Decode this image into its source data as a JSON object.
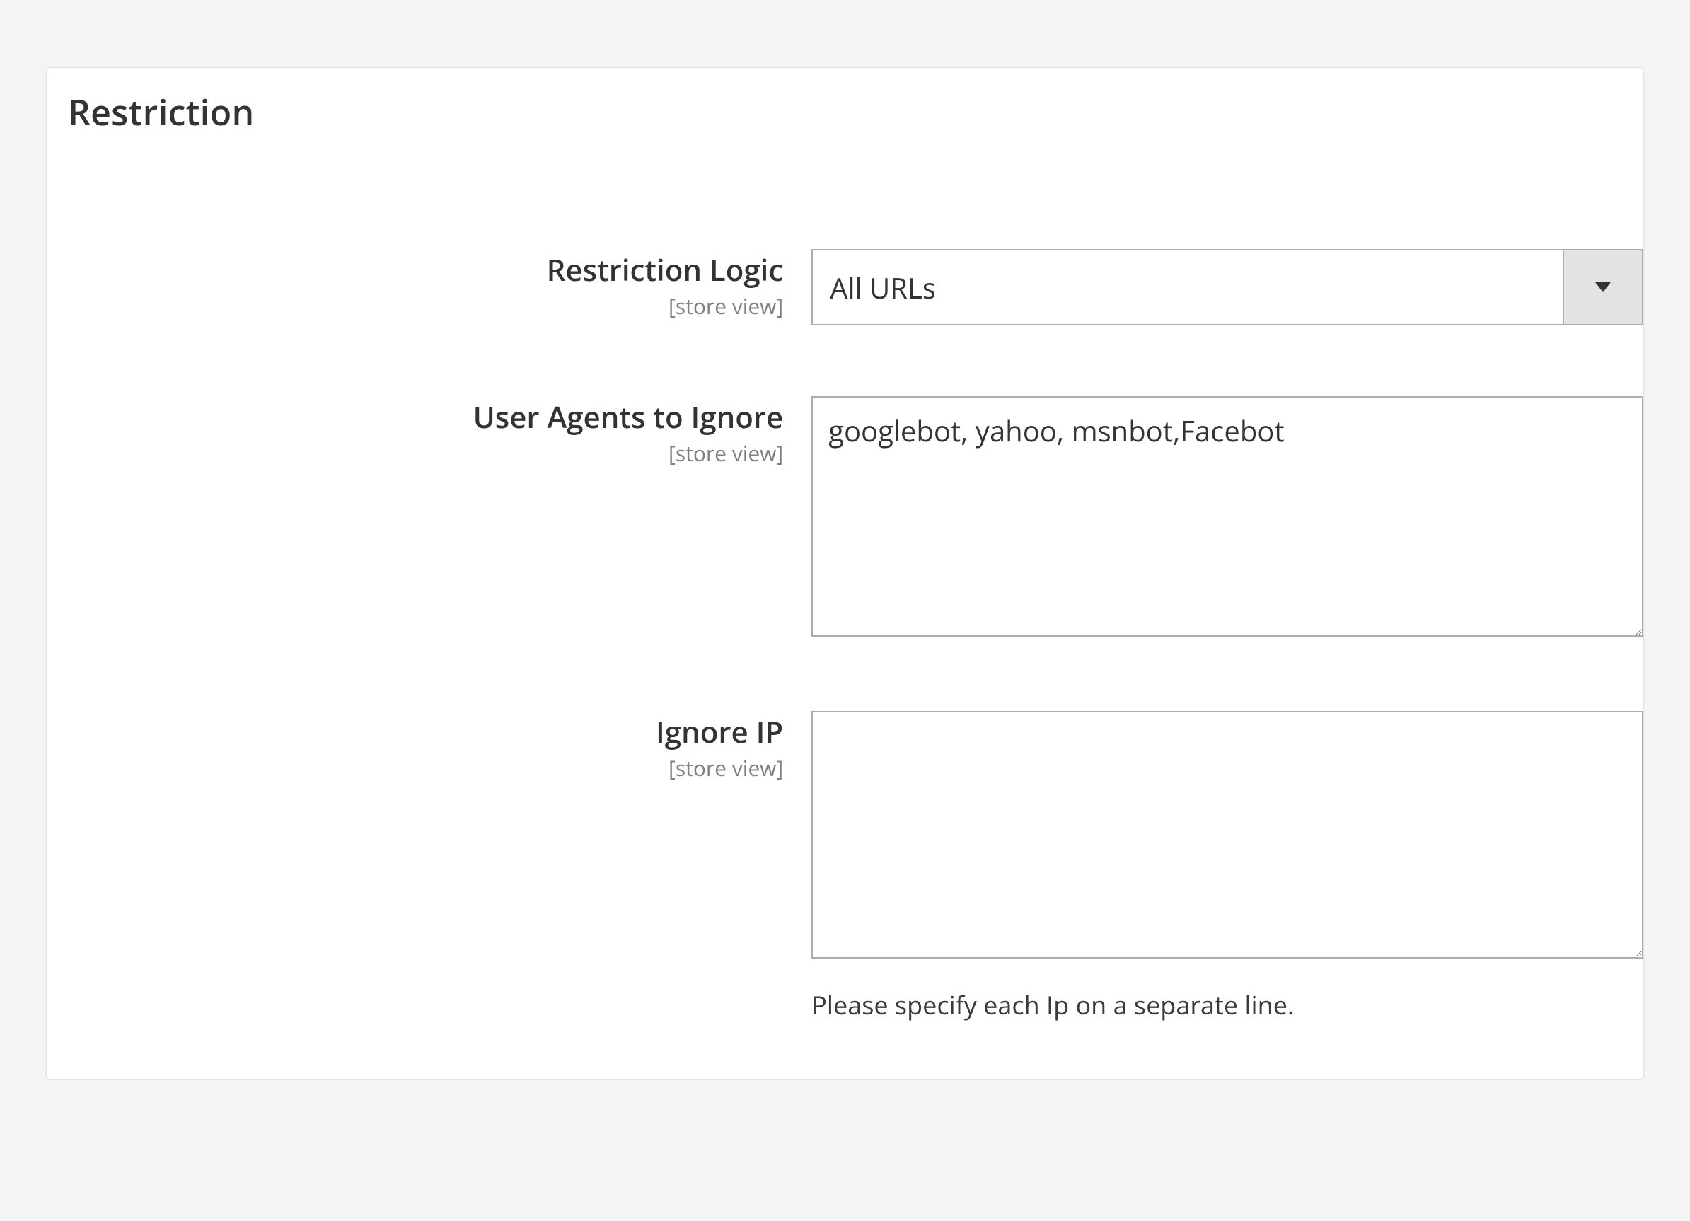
{
  "panel": {
    "title": "Restriction"
  },
  "fields": {
    "restrictionLogic": {
      "label": "Restriction Logic",
      "scope": "[store view]",
      "value": "All URLs"
    },
    "userAgentsIgnore": {
      "label": "User Agents to Ignore",
      "scope": "[store view]",
      "value": "googlebot, yahoo, msnbot,Facebot"
    },
    "ignoreIp": {
      "label": "Ignore IP",
      "scope": "[store view]",
      "value": "",
      "helper": "Please specify each Ip on a separate line."
    }
  }
}
